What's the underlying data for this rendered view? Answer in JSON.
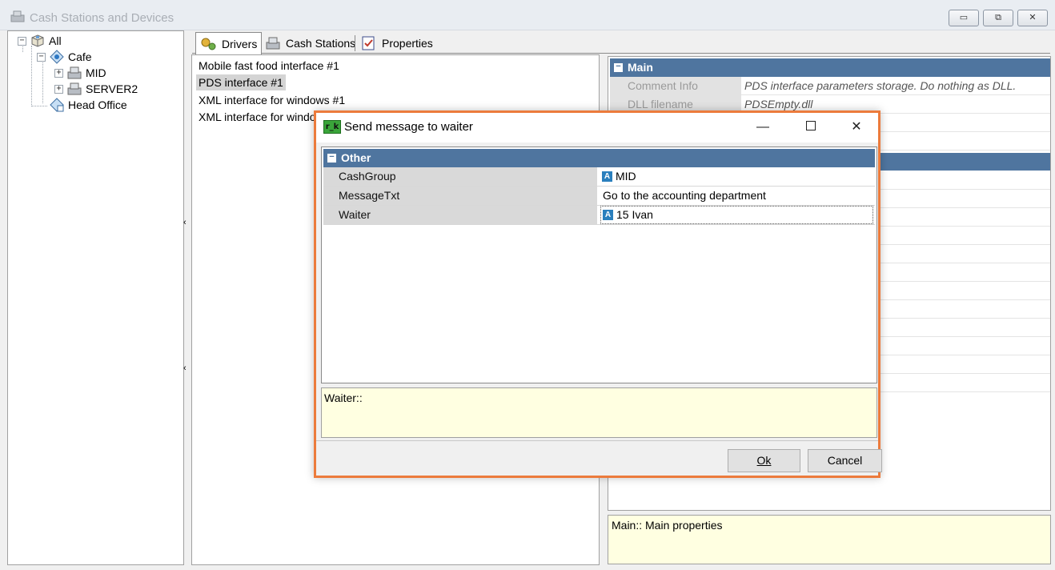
{
  "window": {
    "title": "Cash Stations and Devices",
    "minimize_glyph": "▭",
    "maximize_glyph": "⧉",
    "close_glyph": "✕"
  },
  "tree": {
    "items": [
      {
        "label": "All",
        "icon": "cube-icon",
        "expander": "−"
      },
      {
        "label": "Cafe",
        "icon": "restaurant-node-icon",
        "expander": "−"
      },
      {
        "label": "MID",
        "icon": "cash-station-icon",
        "expander": "+"
      },
      {
        "label": "SERVER2",
        "icon": "cash-station-icon",
        "expander": "+"
      },
      {
        "label": "Head Office",
        "icon": "office-node-icon",
        "expander": ""
      }
    ]
  },
  "tabs": [
    {
      "label": "Drivers",
      "icon": "drivers-icon"
    },
    {
      "label": "Cash Stations",
      "icon": "cash-register-icon"
    },
    {
      "label": "Properties",
      "icon": "properties-icon"
    }
  ],
  "drivers": [
    "Mobile fast food interface #1",
    "PDS interface #1",
    "XML interface for windows #1",
    "XML interface for window"
  ],
  "splitter": {
    "arrow_top": "‹",
    "arrow_bottom": "‹"
  },
  "properties": {
    "section": "Main",
    "collapse_glyph": "−",
    "rows": [
      {
        "key": "Comment Info",
        "value": "PDS interface parameters storage. Do nothing as DLL."
      },
      {
        "key": "DLL filename",
        "value": "PDSEmpty.dll"
      }
    ],
    "description": "Main:: Main properties"
  },
  "dialog": {
    "title": "Send message to waiter",
    "icon_text": "r_k",
    "min_glyph": "—",
    "close_glyph": "✕",
    "section": "Other",
    "rows": [
      {
        "key": "CashGroup",
        "value": "MID",
        "icon": "A"
      },
      {
        "key": "MessageTxt",
        "value": "Go to the accounting department",
        "icon": ""
      },
      {
        "key": "Waiter",
        "value": "15 Ivan",
        "icon": "A"
      }
    ],
    "description": "Waiter::",
    "ok_label": "Ok",
    "cancel_label": "Cancel"
  },
  "colors": {
    "section_header": "#4f759f",
    "dialog_border": "#ec7b3c",
    "description_bg": "#ffffe1"
  }
}
